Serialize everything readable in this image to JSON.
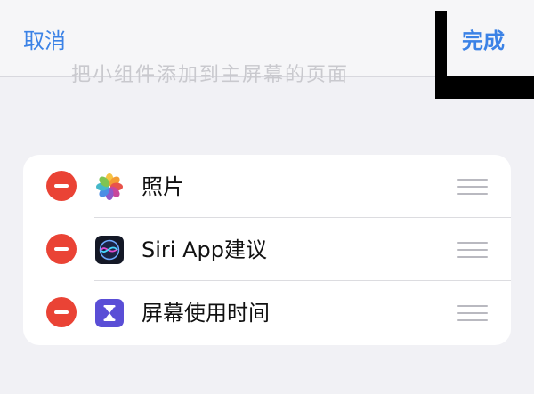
{
  "header": {
    "cancel_label": "取消",
    "done_label": "完成",
    "hidden_text": "把小组件添加到主屏幕的页面"
  },
  "widgets": [
    {
      "label": "照片",
      "icon": "photos-icon"
    },
    {
      "label": "Siri App建议",
      "icon": "siri-icon"
    },
    {
      "label": "屏幕使用时间",
      "icon": "screen-time-icon"
    }
  ],
  "colors": {
    "accent": "#3b82e6",
    "remove": "#ea4335",
    "background": "#f1f1f5",
    "card": "#ffffff",
    "screen_time": "#5a4ed6"
  }
}
